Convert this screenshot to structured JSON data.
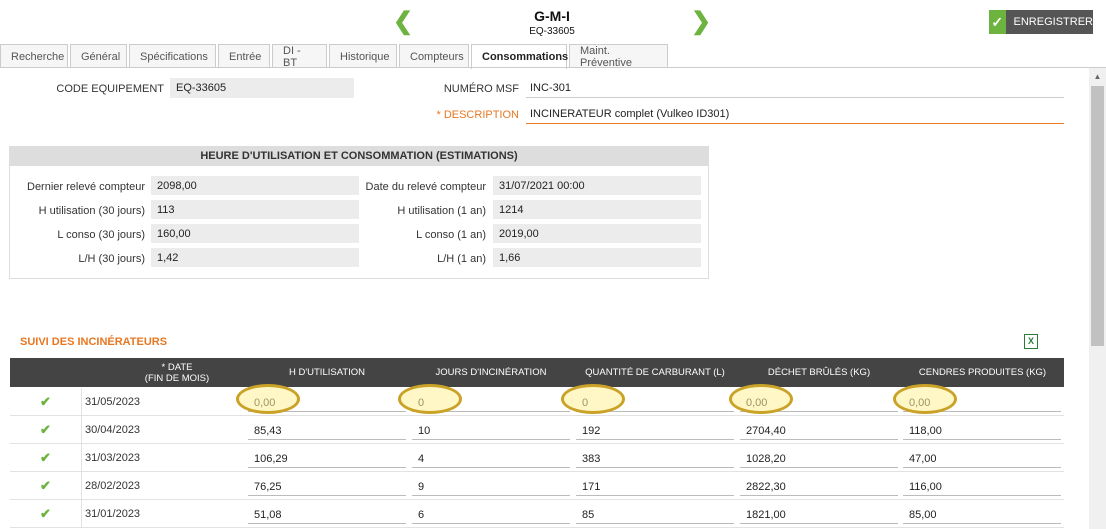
{
  "header": {
    "title": "G-M-I",
    "subtitle": "EQ-33605",
    "save_label": "ENREGISTRER"
  },
  "tabs": [
    "Recherche",
    "Général",
    "Spécifications",
    "Entrée",
    "DI - BT",
    "Historique",
    "Compteurs",
    "Consommations",
    "Maint. Préventive"
  ],
  "active_tab": "Consommations",
  "fields": {
    "code_label": "CODE EQUIPEMENT",
    "code_value": "EQ-33605",
    "msf_label": "NUMÉRO MSF",
    "msf_value": "INC-301",
    "desc_star": "* ",
    "desc_label": "DESCRIPTION",
    "desc_value": "INCINERATEUR complet (Vulkeo ID301)"
  },
  "estimations": {
    "title": "HEURE D'UTILISATION ET CONSOMMATION (ESTIMATIONS)",
    "left": [
      {
        "label": "Dernier relevé compteur",
        "value": "2098,00"
      },
      {
        "label": "H utilisation (30 jours)",
        "value": "113"
      },
      {
        "label": "L conso (30 jours)",
        "value": "160,00"
      },
      {
        "label": "L/H (30 jours)",
        "value": "1,42"
      }
    ],
    "right": [
      {
        "label": "Date du relevé compteur",
        "value": "31/07/2021 00:00"
      },
      {
        "label": "H utilisation (1 an)",
        "value": "1214"
      },
      {
        "label": "L conso (1 an)",
        "value": "2019,00"
      },
      {
        "label": "L/H (1 an)",
        "value": "1,66"
      }
    ]
  },
  "suivi": {
    "title": "SUIVI DES INCINÉRATEURS",
    "excel_icon": "excel-export-icon",
    "headers": [
      "* DATE\n(FIN DE MOIS)",
      "H D'UTILISATION",
      "JOURS D'INCINÉRATION",
      "QUANTITÉ DE CARBURANT (L)",
      "DÉCHET BRÛLÉS (KG)",
      "CENDRES PRODUITES (KG)"
    ],
    "rows": [
      {
        "date": "31/05/2023",
        "h": "0,00",
        "jours": "0",
        "carburant": "0",
        "dechets": "0,00",
        "cendres": "0,00"
      },
      {
        "date": "30/04/2023",
        "h": "85,43",
        "jours": "10",
        "carburant": "192",
        "dechets": "2704,40",
        "cendres": "118,00"
      },
      {
        "date": "31/03/2023",
        "h": "106,29",
        "jours": "4",
        "carburant": "383",
        "dechets": "1028,20",
        "cendres": "47,00"
      },
      {
        "date": "28/02/2023",
        "h": "76,25",
        "jours": "9",
        "carburant": "171",
        "dechets": "2822,30",
        "cendres": "116,00"
      },
      {
        "date": "31/01/2023",
        "h": "51,08",
        "jours": "6",
        "carburant": "85",
        "dechets": "1821,00",
        "cendres": "85,00"
      }
    ]
  },
  "colors": {
    "accent": "#e87722",
    "green": "#6cb33f",
    "highlight": "#c9a227"
  }
}
